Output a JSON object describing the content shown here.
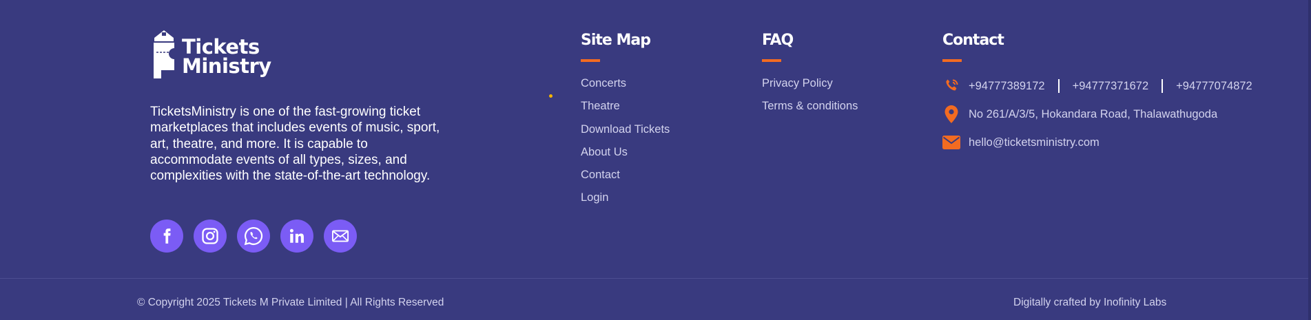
{
  "brand": {
    "logo_line1": "Tickets",
    "logo_line2": "Ministry",
    "description": "TicketsMinistry is one of the fast-growing ticket marketplaces that includes events of music, sport, art, theatre, and more. It is capable to accommodate events of all types, sizes, and complexities with the state-of-the-art technology."
  },
  "socials": [
    {
      "icon": "facebook-icon"
    },
    {
      "icon": "instagram-icon"
    },
    {
      "icon": "whatsapp-icon"
    },
    {
      "icon": "linkedin-icon"
    },
    {
      "icon": "email-icon"
    }
  ],
  "sitemap": {
    "title": "Site Map",
    "links": [
      "Concerts",
      "Theatre",
      "Download Tickets",
      "About Us",
      "Contact",
      "Login"
    ]
  },
  "faq": {
    "title": "FAQ",
    "links": [
      "Privacy Policy",
      "Terms & conditions"
    ]
  },
  "contact": {
    "title": "Contact",
    "phones": [
      "+94777389172",
      "+94777371672",
      "+94777074872"
    ],
    "address": "No 261/A/3/5, Hokandara Road, Thalawathugoda",
    "email": "hello@ticketsministry.com"
  },
  "footer": {
    "copyright": "© Copyright 2025 Tickets M Private Limited | All Rights Reserved",
    "crafted": "Digitally crafted by Inofinity Labs"
  },
  "colors": {
    "background": "#393a7f",
    "accent": "#f36b21",
    "social_bg": "#7b5cf5",
    "link_text": "#d3d3ee"
  }
}
